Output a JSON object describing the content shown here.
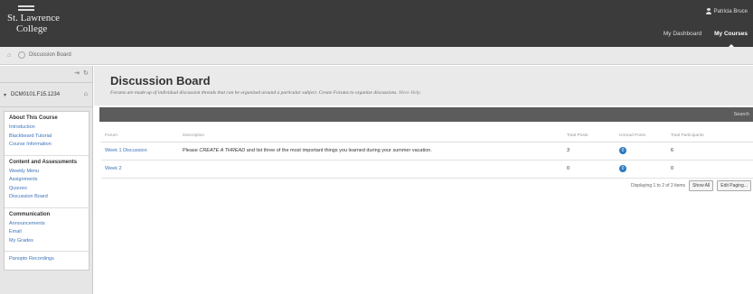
{
  "header": {
    "logo_line1": "St. Lawrence",
    "logo_line2": "College",
    "user_name": "Patricia Bruce",
    "nav": [
      "My Dashboard",
      "My Courses"
    ]
  },
  "breadcrumb": "Discussion Board",
  "sidebar": {
    "course_id": "DCM0101.F15.1234",
    "sections": [
      {
        "title": "About This Course",
        "links": [
          "Introduction",
          "Blackboard Tutorial",
          "Course Information"
        ]
      },
      {
        "title": "Content and Assessments",
        "links": [
          "Weekly Menu",
          "Assignments",
          "Quizzes",
          "Discussion Board"
        ]
      },
      {
        "title": "Communication",
        "links": [
          "Announcements",
          "Email",
          "My Grades"
        ]
      },
      {
        "title": "",
        "links": [
          "Panopto Recordings"
        ]
      }
    ]
  },
  "page": {
    "title": "Discussion Board",
    "description": "Forums are made up of individual discussion threads that can be organized around a particular subject. Create Forums to organize discussions.",
    "more_help": "More Help",
    "search_label": "Search"
  },
  "table": {
    "headers": [
      "Forum",
      "Description",
      "Total Posts",
      "Unread Posts",
      "Total Participants"
    ],
    "rows": [
      {
        "forum": "Week 1 Discussion",
        "desc_pre": "Please ",
        "desc_em": "CREATE A THREAD",
        "desc_post": " and list three of the most important things you learned during your summer vacation.",
        "total": "3",
        "unread": "0",
        "participants": "6"
      },
      {
        "forum": "Week 2",
        "desc_pre": "",
        "desc_em": "",
        "desc_post": "",
        "total": "0",
        "unread": "0",
        "participants": "0"
      }
    ]
  },
  "paging": {
    "status": "Displaying 1 to 2 of 2 items",
    "show_all": "Show All",
    "edit_paging": "Edit Paging..."
  },
  "colors": {
    "header_bg": "#3b3b3b",
    "link": "#3b73b9",
    "badge": "#2a7bbf"
  }
}
